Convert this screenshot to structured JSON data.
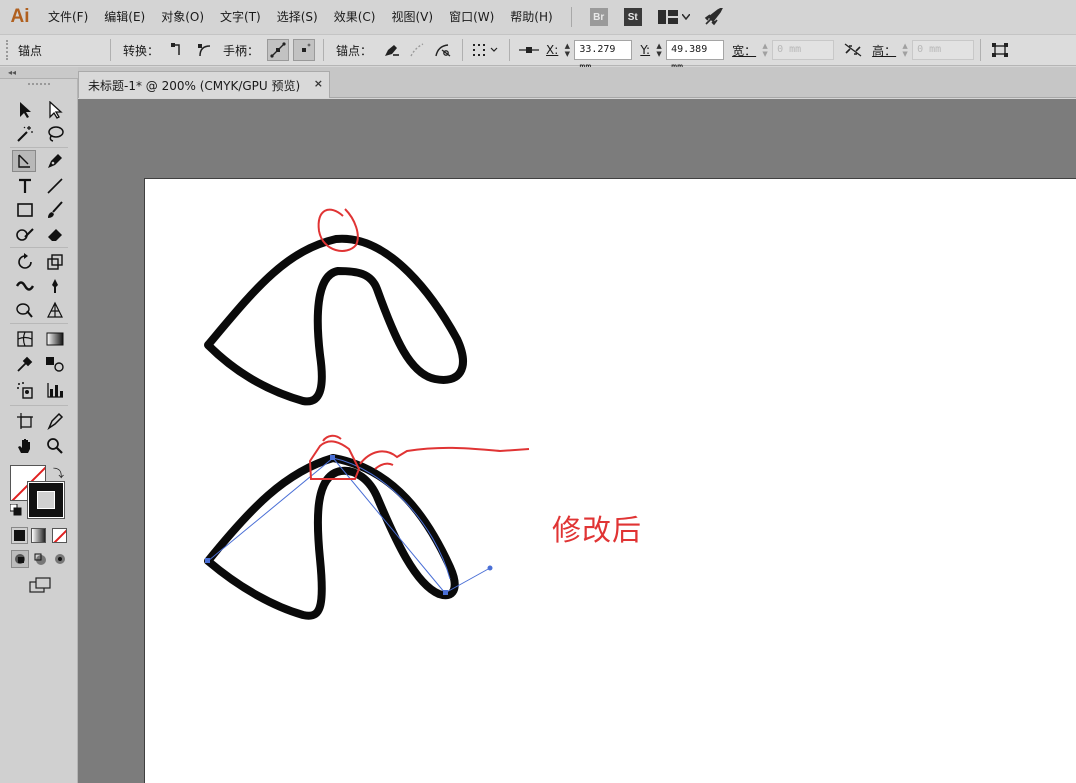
{
  "app": {
    "logo": "Ai",
    "accent": "#b0601f"
  },
  "menu": {
    "items": [
      "文件(F)",
      "编辑(E)",
      "对象(O)",
      "文字(T)",
      "选择(S)",
      "效果(C)",
      "视图(V)",
      "窗口(W)",
      "帮助(H)"
    ],
    "bridge_label": "Br",
    "stock_label": "St"
  },
  "control": {
    "selection_label": "锚点",
    "convert_label": "转换：",
    "handles_label": "手柄：",
    "anchors_label": "锚点：",
    "x_label": "X:",
    "x_value": "33.279 mm",
    "y_label": "Y:",
    "y_value": "49.389 mm",
    "w_label": "宽：",
    "w_value": "0 mm",
    "h_label": "高：",
    "h_value": "0 mm"
  },
  "tab": {
    "title": "未标题-1* @ 200% (CMYK/GPU 预览)",
    "close": "×"
  },
  "canvas": {
    "annotation_text": "修改后",
    "annotation_color": "#e03434",
    "path_color": "#0a0a0a",
    "handle_color": "#4a6fd6"
  },
  "icons": [
    "selection-icon",
    "direct-selection-icon",
    "magic-wand-icon",
    "lasso-icon",
    "pen-icon",
    "curvature-icon",
    "type-icon",
    "line-icon",
    "rectangle-icon",
    "paintbrush-icon",
    "shaper-icon",
    "eraser-icon",
    "rotate-icon",
    "scale-icon",
    "width-icon",
    "puppet-warp-icon",
    "shape-builder-icon",
    "perspective-grid-icon",
    "mesh-icon",
    "gradient-icon",
    "eyedropper-icon",
    "blend-icon",
    "symbol-sprayer-icon",
    "column-graph-icon",
    "artboard-icon",
    "slice-icon",
    "hand-icon",
    "zoom-icon"
  ]
}
